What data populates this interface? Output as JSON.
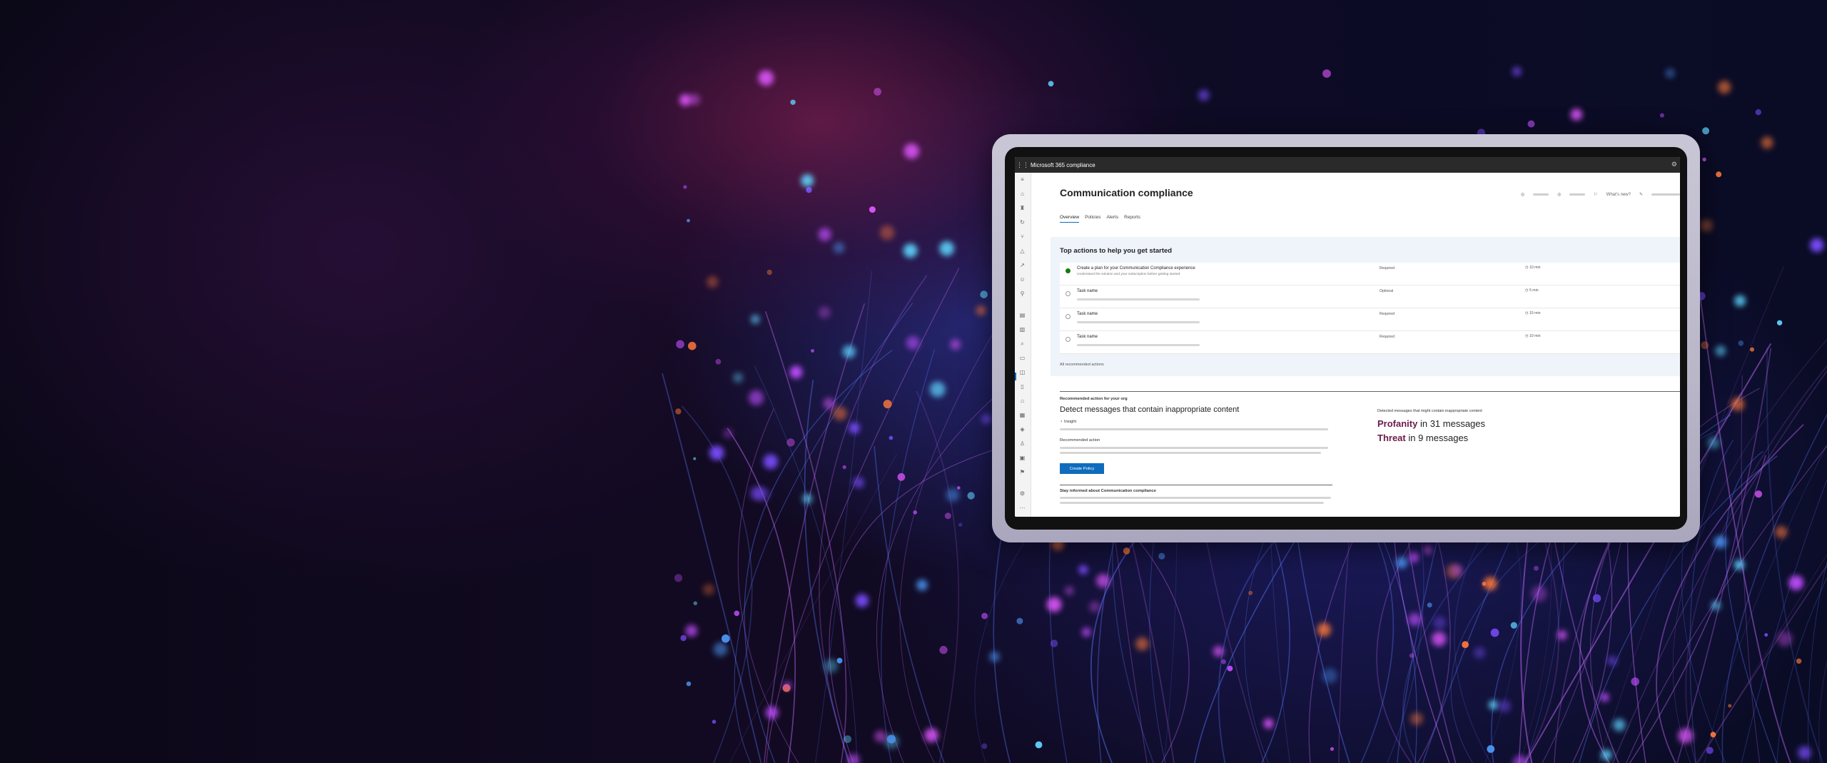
{
  "app": {
    "title": "Microsoft 365 compliance"
  },
  "page": {
    "title": "Communication compliance",
    "header_links": {
      "whats_new": "What's new?"
    },
    "tabs": [
      {
        "label": "Overview",
        "active": true
      },
      {
        "label": "Policies",
        "active": false
      },
      {
        "label": "Alerts",
        "active": false
      },
      {
        "label": "Reports",
        "active": false
      }
    ]
  },
  "top_actions": {
    "title": "Top actions to help you get started",
    "tasks": [
      {
        "name": "Create a plan for your Communication Compliance experience",
        "description": "Understand the solution and your subscription before getting started",
        "requirement": "Required",
        "time": "10 min",
        "done": true
      },
      {
        "name": "Task name",
        "description": "",
        "requirement": "Optional",
        "time": "5 min",
        "done": false
      },
      {
        "name": "Task name",
        "description": "",
        "requirement": "Required",
        "time": "15 min",
        "done": false
      },
      {
        "name": "Task name",
        "description": "",
        "requirement": "Required",
        "time": "10 min",
        "done": false
      }
    ],
    "all_link": "All recommended actions"
  },
  "recommended": {
    "label": "Recommended action for your org",
    "title": "Detect messages that contain inappropriate content",
    "insight": "Insight",
    "action_label": "Recommended action",
    "button": "Create Policy",
    "stay_informed": "Stay informed about Communication compliance"
  },
  "detected": {
    "label": "Detected messages that might contain inappropriate content",
    "items": [
      {
        "keyword": "Profanity",
        "rest": "in 31 messages"
      },
      {
        "keyword": "Threat",
        "rest": "in 9 messages"
      }
    ]
  },
  "icons": {
    "waffle": "app-launcher-icon",
    "settings": "gear-icon",
    "check": "check-circle-icon",
    "timer": "clock-icon",
    "insight": "lightbulb-icon"
  },
  "colors": {
    "accent": "#0f6cbd",
    "keyword": "#6b1a4a",
    "success": "#107c10"
  }
}
